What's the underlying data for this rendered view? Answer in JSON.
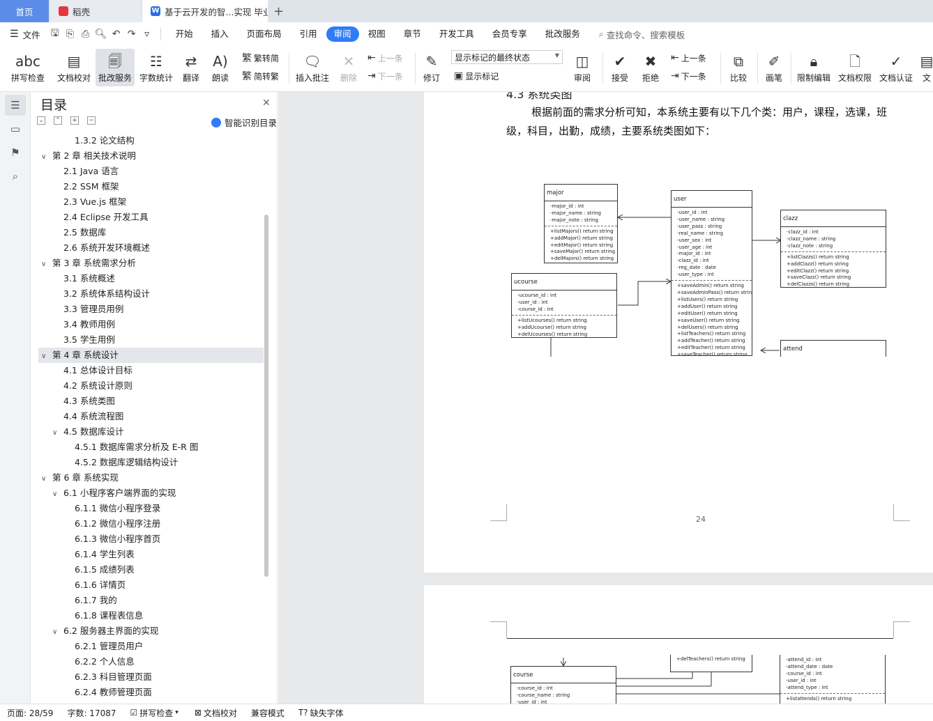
{
  "tabs": {
    "home": "首页",
    "docer": "稻壳",
    "doc": "基于云开发的智...实现 毕业论文"
  },
  "menu": {
    "file": "文件",
    "items": [
      "开始",
      "插入",
      "页面布局",
      "引用",
      "审阅",
      "视图",
      "章节",
      "开发工具",
      "会员专享",
      "批改服务"
    ],
    "active": "审阅",
    "search": "查找命令、搜索模板"
  },
  "ribbon": {
    "spell": "拼写检查",
    "doccheck": "文档校对",
    "correct": "批改服务",
    "wordcount": "字数统计",
    "translate": "翻译",
    "read": "朗读",
    "trad": "繁转简",
    "simp": "简转繁",
    "insert_comment": "插入批注",
    "delete": "删除",
    "prev": "上一条",
    "next": "下一条",
    "revise": "修订",
    "markup_state": "显示标记的最终状态",
    "show_markup": "显示标记",
    "review": "审阅",
    "accept": "接受",
    "reject": "拒绝",
    "prev2": "上一条",
    "next2": "下一条",
    "compare": "比较",
    "pen": "画笔",
    "restrict": "限制编辑",
    "rights": "文档权限",
    "certify": "文档认证",
    "cut": "文"
  },
  "toc": {
    "title": "目录",
    "smart": "智能识别目录",
    "items": [
      {
        "text": "1.3.2 论文结构",
        "level": "l3",
        "caret": ""
      },
      {
        "text": "第 2 章  相关技术说明",
        "level": "l1",
        "caret": "v"
      },
      {
        "text": "2.1 Java 语言",
        "level": "l2",
        "caret": ""
      },
      {
        "text": "2.2 SSM 框架",
        "level": "l2",
        "caret": ""
      },
      {
        "text": "2.3 Vue.js 框架",
        "level": "l2",
        "caret": ""
      },
      {
        "text": "2.4 Eclipse 开发工具",
        "level": "l2",
        "caret": ""
      },
      {
        "text": "2.5  数据库",
        "level": "l2",
        "caret": ""
      },
      {
        "text": "2.6 系统开发环境概述",
        "level": "l2",
        "caret": ""
      },
      {
        "text": "第 3 章  系统需求分析",
        "level": "l1",
        "caret": "v"
      },
      {
        "text": "3.1 系统概述",
        "level": "l2",
        "caret": ""
      },
      {
        "text": "3.2 系统体系结构设计",
        "level": "l2",
        "caret": ""
      },
      {
        "text": "3.3 管理员用例",
        "level": "l2",
        "caret": ""
      },
      {
        "text": "3.4 教师用例",
        "level": "l2",
        "caret": ""
      },
      {
        "text": "3.5 学生用例",
        "level": "l2",
        "caret": ""
      },
      {
        "text": "第 4 章  系统设计",
        "level": "l1 sel",
        "caret": "v"
      },
      {
        "text": "4.1 总体设计目标",
        "level": "l2",
        "caret": ""
      },
      {
        "text": "4.2 系统设计原则",
        "level": "l2",
        "caret": ""
      },
      {
        "text": "4.3 系统类图",
        "level": "l2",
        "caret": ""
      },
      {
        "text": "4.4 系统流程图",
        "level": "l2",
        "caret": ""
      },
      {
        "text": "4.5 数据库设计",
        "level": "l2c",
        "caret": "v"
      },
      {
        "text": "4.5.1 数据库需求分析及 E-R 图",
        "level": "l3",
        "caret": ""
      },
      {
        "text": "4.5.2  数据库逻辑结构设计",
        "level": "l3",
        "caret": ""
      },
      {
        "text": "第 6 章  系统实现",
        "level": "l1",
        "caret": "v"
      },
      {
        "text": "6.1  小程序客户端界面的实现",
        "level": "l2c",
        "caret": "v"
      },
      {
        "text": "6.1.1  微信小程序登录",
        "level": "l3",
        "caret": ""
      },
      {
        "text": "6.1.2 微信小程序注册",
        "level": "l3",
        "caret": ""
      },
      {
        "text": "6.1.3 微信小程序首页",
        "level": "l3",
        "caret": ""
      },
      {
        "text": "6.1.4 学生列表",
        "level": "l3",
        "caret": ""
      },
      {
        "text": "6.1.5 成绩列表",
        "level": "l3",
        "caret": ""
      },
      {
        "text": "6.1.6 详情页",
        "level": "l3",
        "caret": ""
      },
      {
        "text": "6.1.7 我的",
        "level": "l3",
        "caret": ""
      },
      {
        "text": "6.1.8 课程表信息",
        "level": "l3",
        "caret": ""
      },
      {
        "text": "6.2  服务器主界面的实现",
        "level": "l2c",
        "caret": "v"
      },
      {
        "text": "6.2.1 管理员用户",
        "level": "l3",
        "caret": ""
      },
      {
        "text": "6.2.2 个人信息",
        "level": "l3",
        "caret": ""
      },
      {
        "text": "6.2.3 科目管理页面",
        "level": "l3",
        "caret": ""
      },
      {
        "text": "6.2.4 教师管理页面",
        "level": "l3",
        "caret": ""
      }
    ]
  },
  "doc": {
    "heading_fragment": "4.3  系统类图",
    "paragraph": "根据前面的需求分析可知，本系统主要有以下几个类：用户，课程，选课，班级，科目，出勤，成绩，主要系统类图如下：",
    "page_number": "24",
    "classes": {
      "major": {
        "name": "major",
        "attrs": [
          "-major_id : int",
          "-major_name : string",
          "-major_note : string"
        ],
        "methods": [
          "+listMajors() return string",
          "+addMajor() return string",
          "+editMajor() return string",
          "+saveMajor() return string",
          "+delMajors() return string"
        ]
      },
      "user": {
        "name": "user",
        "attrs": [
          "-user_id : int",
          "-user_name : string",
          "-user_pass : string",
          "-real_name : string",
          "-user_sex : int",
          "-user_age : int",
          "-major_id : int",
          "-clazz_id : int",
          "-reg_date : date",
          "-user_type : int"
        ],
        "methods": [
          "+saveAdmin() return string",
          "+saveAdminPass() return string",
          "+listUsers() return string",
          "+addUser() return string",
          "+editUser() return string",
          "+saveUser() return string",
          "+delUsers() return string",
          "+listTeachers() return string",
          "+addTeacher() return string",
          "+editTeacher() return string",
          "+saveTeacher() return string"
        ]
      },
      "clazz": {
        "name": "clazz",
        "attrs": [
          "-clazz_id : int",
          "-clazz_name : string",
          "-clazz_note : string"
        ],
        "methods": [
          "+listClazzs() return string",
          "+addClazz() return string",
          "+editClazz() return string",
          "+saveClazz() return string",
          "+delClazzs() return string"
        ]
      },
      "ucourse": {
        "name": "ucourse",
        "attrs": [
          "-ucourse_id : int",
          "-user_id : int",
          "-course_id : int"
        ],
        "methods": [
          "+listUcourses() return string",
          "+addUcourse() return string",
          "+delUcourses() return string"
        ]
      },
      "attend": {
        "name": "attend"
      },
      "course": {
        "name": "course",
        "attrs": [
          "-course_id : int",
          "-course_name : string",
          "-user_id : int"
        ]
      },
      "user_tail": {
        "method": "+delTeachers() return string"
      },
      "attend_tail": {
        "attrs": [
          "-attend_id : int",
          "-attend_date : date",
          "-course_id : int",
          "-user_id : int",
          "-attend_type : int"
        ],
        "methods": [
          "+listattends() return string"
        ]
      }
    }
  },
  "status": {
    "page": "页面: 28/59",
    "words": "字数: 17087",
    "spell": "拼写检查",
    "doccheck": "文档校对",
    "compat": "兼容模式",
    "missing_font": "缺失字体"
  }
}
